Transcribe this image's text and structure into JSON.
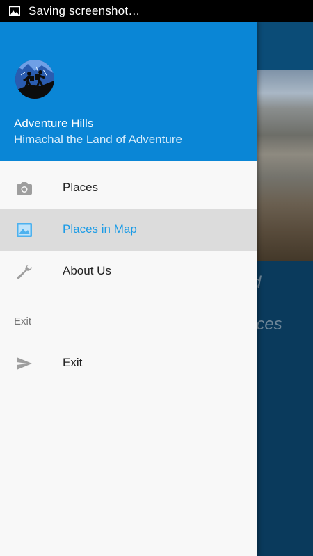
{
  "status_bar": {
    "text": "Saving screenshot…",
    "icon": "image-icon"
  },
  "background": {
    "text_line1": "d",
    "text_line2": "aces"
  },
  "drawer": {
    "header": {
      "title": "Adventure Hills",
      "subtitle": "Himachal the Land of Adventure",
      "background_color": "#0a86d6"
    },
    "items": [
      {
        "label": "Places",
        "icon": "camera-icon",
        "active": false
      },
      {
        "label": "Places in Map",
        "icon": "image-icon",
        "active": true
      },
      {
        "label": "About Us",
        "icon": "wrench-icon",
        "active": false
      }
    ],
    "section_label": "Exit",
    "exit_item": {
      "label": "Exit",
      "icon": "send-icon"
    },
    "accent_color": "#1a9be6"
  }
}
